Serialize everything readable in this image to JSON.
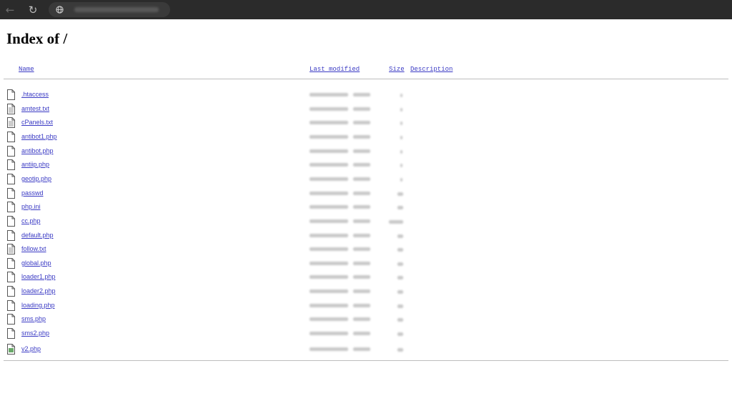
{
  "page": {
    "title": "Index of /"
  },
  "columns": {
    "name": "Name",
    "last_modified": "Last modified",
    "size": "Size",
    "description": "Description"
  },
  "files": [
    {
      "name": ".htaccess",
      "icon": "file-icon"
    },
    {
      "name": "amtest.txt",
      "icon": "text-file-icon"
    },
    {
      "name": "cPanels.txt",
      "icon": "text-file-icon"
    },
    {
      "name": "antibot1.php",
      "icon": "file-icon"
    },
    {
      "name": "antibot.php",
      "icon": "file-icon"
    },
    {
      "name": "antiip.php",
      "icon": "file-icon"
    },
    {
      "name": "geotip.php",
      "icon": "file-icon"
    },
    {
      "name": "passwd",
      "icon": "file-icon"
    },
    {
      "name": "php.ini",
      "icon": "file-icon"
    },
    {
      "name": "cc.php",
      "icon": "file-icon"
    },
    {
      "name": "default.php",
      "icon": "file-icon"
    },
    {
      "name": "follow.txt",
      "icon": "text-file-icon"
    },
    {
      "name": "global.php",
      "icon": "file-icon"
    },
    {
      "name": "loader1.php",
      "icon": "file-icon"
    },
    {
      "name": "loader2.php",
      "icon": "file-icon"
    },
    {
      "name": "loading.php",
      "icon": "file-icon"
    },
    {
      "name": "sms.php",
      "icon": "file-icon"
    },
    {
      "name": "sms2.php",
      "icon": "file-icon"
    },
    {
      "name": "v2.php",
      "icon": "script-file-icon"
    }
  ],
  "colors": {
    "link": "#3a3ac4",
    "browser_bar": "#2b2b2b"
  }
}
